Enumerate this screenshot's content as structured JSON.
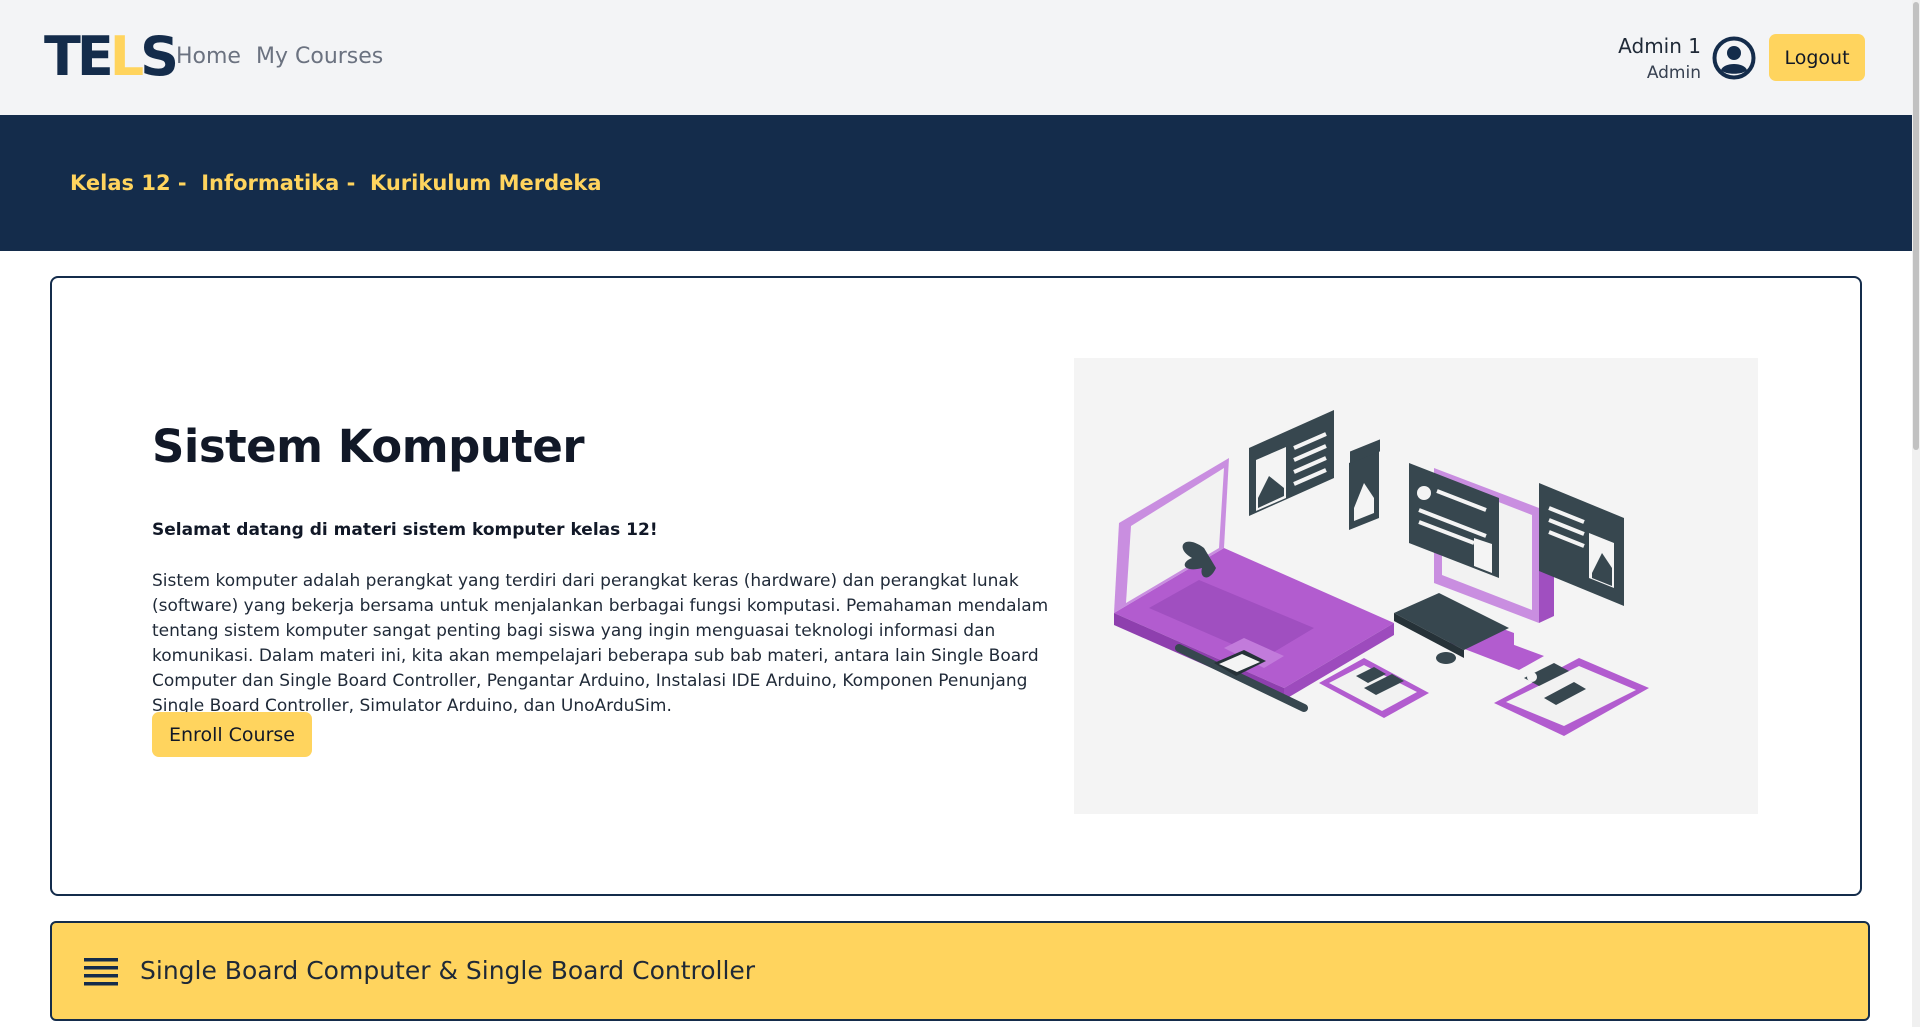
{
  "navbar": {
    "logo_text": "TELS",
    "links": [
      "Home",
      "My Courses"
    ],
    "user_name": "Admin 1",
    "user_role": "Admin",
    "logout_label": "Logout"
  },
  "banner": {
    "breadcrumb": "Kelas 12 -  Informatika -  Kurikulum Merdeka"
  },
  "course": {
    "title": "Sistem Komputer",
    "welcome": "Selamat datang di materi sistem komputer kelas 12!",
    "description": "Sistem komputer adalah perangkat yang terdiri dari perangkat keras (hardware) dan perangkat lunak (software) yang bekerja bersama untuk menjalankan berbagai fungsi komputasi. Pemahaman mendalam tentang sistem komputer sangat penting bagi siswa yang ingin menguasai teknologi informasi dan komunikasi. Dalam materi ini, kita akan mempelajari beberapa sub bab materi, antara lain Single Board Computer dan Single Board Controller, Pengantar Arduino, Instalasi IDE Arduino, Komponen Penunjang Single Board Controller, Simulator Arduino, dan UnoArduSim.",
    "enroll_label": "Enroll Course"
  },
  "sections": [
    {
      "title": "Single Board Computer & Single Board Controller"
    }
  ],
  "colors": {
    "navy": "#142c4b",
    "yellow": "#ffd45e",
    "purple": "#b25ccf"
  }
}
